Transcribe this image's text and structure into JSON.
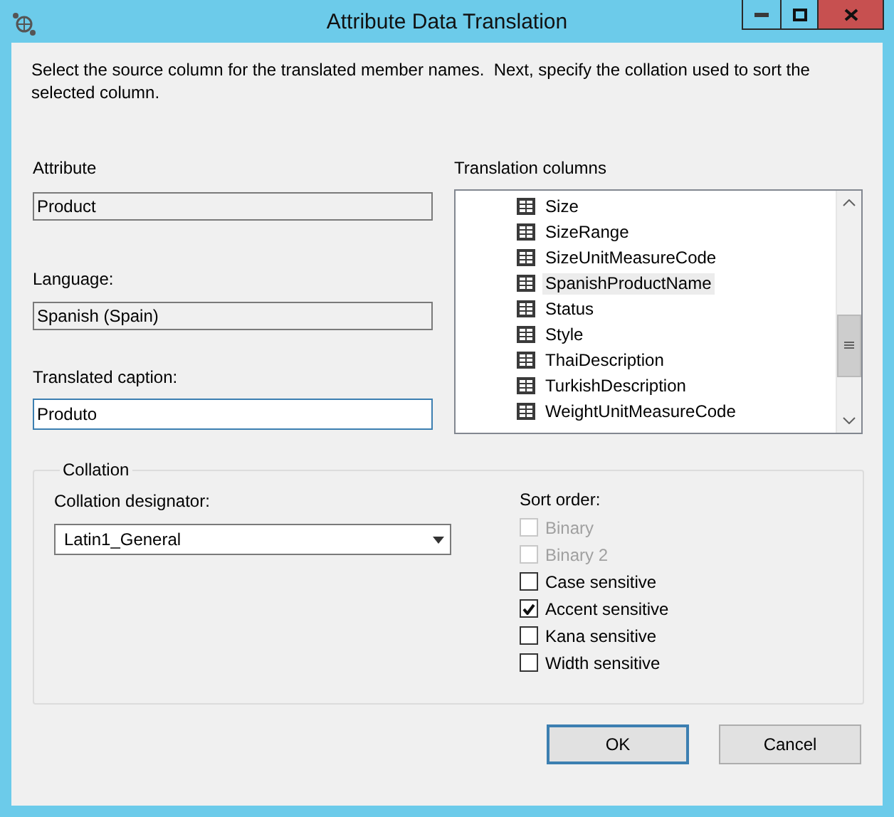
{
  "window": {
    "title": "Attribute Data Translation"
  },
  "instructions": "Select the source column for the translated member names.  Next, specify the collation used to sort the selected column.",
  "attribute": {
    "label": "Attribute",
    "value": "Product"
  },
  "language": {
    "label": "Language:",
    "value": "Spanish (Spain)"
  },
  "caption": {
    "label": "Translated caption:",
    "value": "Produto"
  },
  "translation_columns": {
    "label": "Translation columns",
    "items": [
      {
        "label": "Size",
        "selected": false
      },
      {
        "label": "SizeRange",
        "selected": false
      },
      {
        "label": "SizeUnitMeasureCode",
        "selected": false
      },
      {
        "label": "SpanishProductName",
        "selected": true
      },
      {
        "label": "Status",
        "selected": false
      },
      {
        "label": "Style",
        "selected": false
      },
      {
        "label": "ThaiDescription",
        "selected": false
      },
      {
        "label": "TurkishDescription",
        "selected": false
      },
      {
        "label": "WeightUnitMeasureCode",
        "selected": false
      }
    ]
  },
  "collation": {
    "title": "Collation",
    "designator_label": "Collation designator:",
    "designator": "Latin1_General",
    "sort_order_label": "Sort order:",
    "options": [
      {
        "label": "Binary",
        "checked": false,
        "disabled": true
      },
      {
        "label": "Binary 2",
        "checked": false,
        "disabled": true
      },
      {
        "label": "Case sensitive",
        "checked": false,
        "disabled": false
      },
      {
        "label": "Accent sensitive",
        "checked": true,
        "disabled": false
      },
      {
        "label": "Kana sensitive",
        "checked": false,
        "disabled": false
      },
      {
        "label": "Width sensitive",
        "checked": false,
        "disabled": false
      }
    ]
  },
  "buttons": [
    {
      "label": "OK",
      "kind": "default"
    },
    {
      "label": "Cancel",
      "kind": "normal"
    }
  ]
}
